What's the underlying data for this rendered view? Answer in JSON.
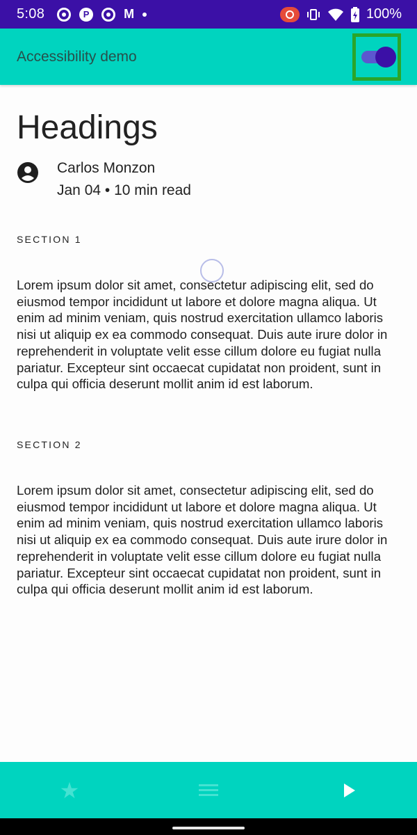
{
  "status_bar": {
    "time": "5:08",
    "battery": "100%",
    "icons": [
      "ring-notification-icon",
      "p-app-icon",
      "ring-notification-icon",
      "gmail-icon",
      "more-dot-icon",
      "screen-record-icon",
      "vibrate-icon",
      "wifi-icon",
      "battery-charging-icon"
    ]
  },
  "app_bar": {
    "title": "Accessibility demo",
    "toggle_on": true
  },
  "article": {
    "heading": "Headings",
    "author": "Carlos Monzon",
    "meta": "Jan 04 • 10 min read",
    "sections": [
      {
        "label": "SECTION 1",
        "body": "Lorem ipsum dolor sit amet, consectetur adipiscing elit, sed do eiusmod tempor incididunt ut labore et dolore magna aliqua. Ut enim ad minim veniam, quis nostrud exercitation ullamco laboris nisi ut aliquip ex ea commodo consequat. Duis aute irure dolor in reprehenderit in voluptate velit esse cillum dolore eu fugiat nulla pariatur. Excepteur sint occaecat cupidatat non proident, sunt in culpa qui officia deserunt mollit anim id est laborum."
      },
      {
        "label": "SECTION 2",
        "body": "Lorem ipsum dolor sit amet, consectetur adipiscing elit, sed do eiusmod tempor incididunt ut labore et dolore magna aliqua. Ut enim ad minim veniam, quis nostrud exercitation ullamco laboris nisi ut aliquip ex ea commodo consequat. Duis aute irure dolor in reprehenderit in voluptate velit esse cillum dolore eu fugiat nulla pariatur. Excepteur sint occaecat cupidatat non proident, sunt in culpa qui officia deserunt mollit anim id est laborum."
      }
    ]
  },
  "bottom_nav": {
    "items": [
      "star-icon",
      "list-icon",
      "play-icon"
    ]
  },
  "colors": {
    "status_bar": "#3b10a6",
    "app_bar": "#00d4bf",
    "toggle_highlight": "#2aa52a"
  }
}
